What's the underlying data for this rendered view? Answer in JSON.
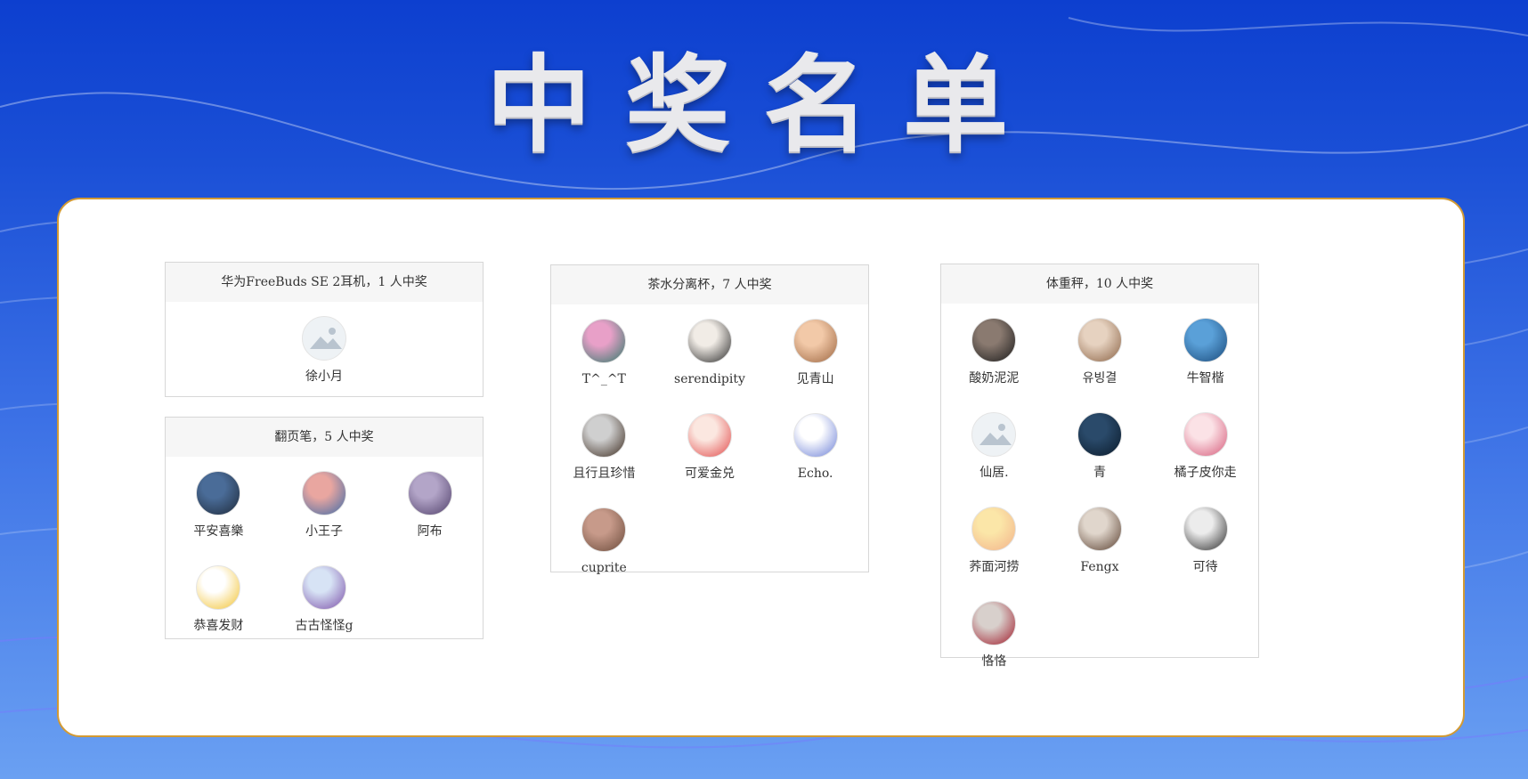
{
  "page_title": "中奖名单",
  "prizes": [
    {
      "title": "华为FreeBuds SE 2耳机，1 人中奖",
      "winners": [
        {
          "name": "徐小月",
          "avatar": "placeholder-avatar-icon",
          "c1": "#eef2f5",
          "c2": "#b9c4cf"
        }
      ]
    },
    {
      "title": "翻页笔，5 人中奖",
      "winners": [
        {
          "name": "平安喜樂",
          "avatar": "avatar-photo",
          "c1": "#4a6c98",
          "c2": "#1e2a3a"
        },
        {
          "name": "小王子",
          "avatar": "avatar-photo",
          "c1": "#e9a6a0",
          "c2": "#3c6aa8"
        },
        {
          "name": "阿布",
          "avatar": "avatar-photo",
          "c1": "#b3a5c8",
          "c2": "#50406a"
        },
        {
          "name": "恭喜发财",
          "avatar": "avatar-photo",
          "c1": "#ffffff",
          "c2": "#f2c230"
        },
        {
          "name": "古古怪怪g",
          "avatar": "avatar-photo",
          "c1": "#d7e3f5",
          "c2": "#7b4fa8"
        }
      ]
    },
    {
      "title": "茶水分离杯，7 人中奖",
      "winners": [
        {
          "name": "T^_^T",
          "avatar": "avatar-photo",
          "c1": "#e8a0c8",
          "c2": "#2f7a6a"
        },
        {
          "name": "serendipity",
          "avatar": "avatar-photo",
          "c1": "#f1ece6",
          "c2": "#2a2a2a"
        },
        {
          "name": "见青山",
          "avatar": "avatar-photo",
          "c1": "#f2c9a8",
          "c2": "#9c6540"
        },
        {
          "name": "且行且珍惜",
          "avatar": "avatar-photo",
          "c1": "#cfcfcf",
          "c2": "#3b2a1e"
        },
        {
          "name": "可爱金兑",
          "avatar": "avatar-photo",
          "c1": "#fbe7e0",
          "c2": "#e24a4a"
        },
        {
          "name": "Echo.",
          "avatar": "avatar-photo",
          "c1": "#ffffff",
          "c2": "#6b7fd6"
        },
        {
          "name": "cuprite",
          "avatar": "avatar-photo",
          "c1": "#c79a8a",
          "c2": "#6a4a3a"
        }
      ]
    },
    {
      "title": "体重秤，10 人中奖",
      "winners": [
        {
          "name": "酸奶泥泥",
          "avatar": "avatar-photo",
          "c1": "#8a7a70",
          "c2": "#1a1a1a"
        },
        {
          "name": "유빙결",
          "avatar": "avatar-photo",
          "c1": "#e6d2c0",
          "c2": "#8a6244"
        },
        {
          "name": "牛智楷",
          "avatar": "avatar-photo",
          "c1": "#5aa0d8",
          "c2": "#1a4a7a"
        },
        {
          "name": "仙居.",
          "avatar": "placeholder-avatar-icon",
          "c1": "#eef2f5",
          "c2": "#b9c4cf"
        },
        {
          "name": "青",
          "avatar": "avatar-photo",
          "c1": "#2a4a6a",
          "c2": "#0a1a2a"
        },
        {
          "name": "橘子皮你走",
          "avatar": "avatar-photo",
          "c1": "#fbe2e6",
          "c2": "#d65a7a"
        },
        {
          "name": "荞面河捞",
          "avatar": "avatar-photo",
          "c1": "#fbe6a8",
          "c2": "#f2b28a"
        },
        {
          "name": "Fengx",
          "avatar": "avatar-photo",
          "c1": "#e0d6cc",
          "c2": "#5a4030"
        },
        {
          "name": "可待",
          "avatar": "avatar-photo",
          "c1": "#ececec",
          "c2": "#2a2a2a"
        },
        {
          "name": "恪恪",
          "avatar": "avatar-photo",
          "c1": "#d8d0cc",
          "c2": "#a01a2a"
        }
      ]
    }
  ]
}
